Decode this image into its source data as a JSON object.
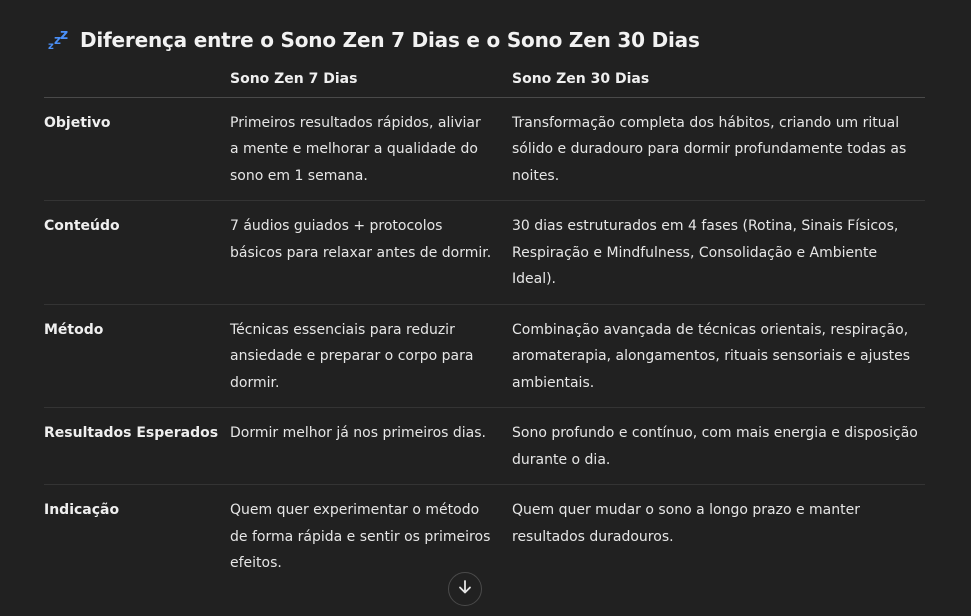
{
  "heading": {
    "icon": "zzz-sleep-icon",
    "title": "Diferença entre o Sono Zen 7 Dias e o Sono Zen 30 Dias"
  },
  "table": {
    "headers": [
      "",
      "Sono Zen 7 Dias",
      "Sono Zen 30 Dias"
    ],
    "rows": [
      {
        "label": "Objetivo",
        "zen7": "Primeiros resultados rápidos, aliviar a mente e melhorar a qualidade do sono em 1 semana.",
        "zen30": "Transformação completa dos hábitos, criando um ritual sólido e duradouro para dormir profundamente todas as noites."
      },
      {
        "label": "Conteúdo",
        "zen7": "7 áudios guiados + protocolos básicos para relaxar antes de dormir.",
        "zen30": "30 dias estruturados em 4 fases (Rotina, Sinais Físicos, Respiração e Mindfulness, Consolidação e Ambiente Ideal)."
      },
      {
        "label": "Método",
        "zen7": "Técnicas essenciais para reduzir ansiedade e preparar o corpo para dormir.",
        "zen30": "Combinação avançada de técnicas orientais, respiração, aromaterapia, alongamentos, rituais sensoriais e ajustes ambientais."
      },
      {
        "label": "Resultados Esperados",
        "zen7": "Dormir melhor já nos primeiros dias.",
        "zen30": "Sono profundo e contínuo, com mais energia e disposição durante o dia."
      },
      {
        "label": "Indicação",
        "zen7": "Quem quer experimentar o método de forma rápida e sentir os primeiros efeitos.",
        "zen30": "Quem quer mudar o sono a longo prazo e manter resultados duradouros."
      }
    ]
  },
  "scroll_button": {
    "icon": "arrow-down-icon"
  },
  "colors": {
    "background": "#212121",
    "text": "#ececec",
    "zzz_icon": "#3b82f6"
  }
}
